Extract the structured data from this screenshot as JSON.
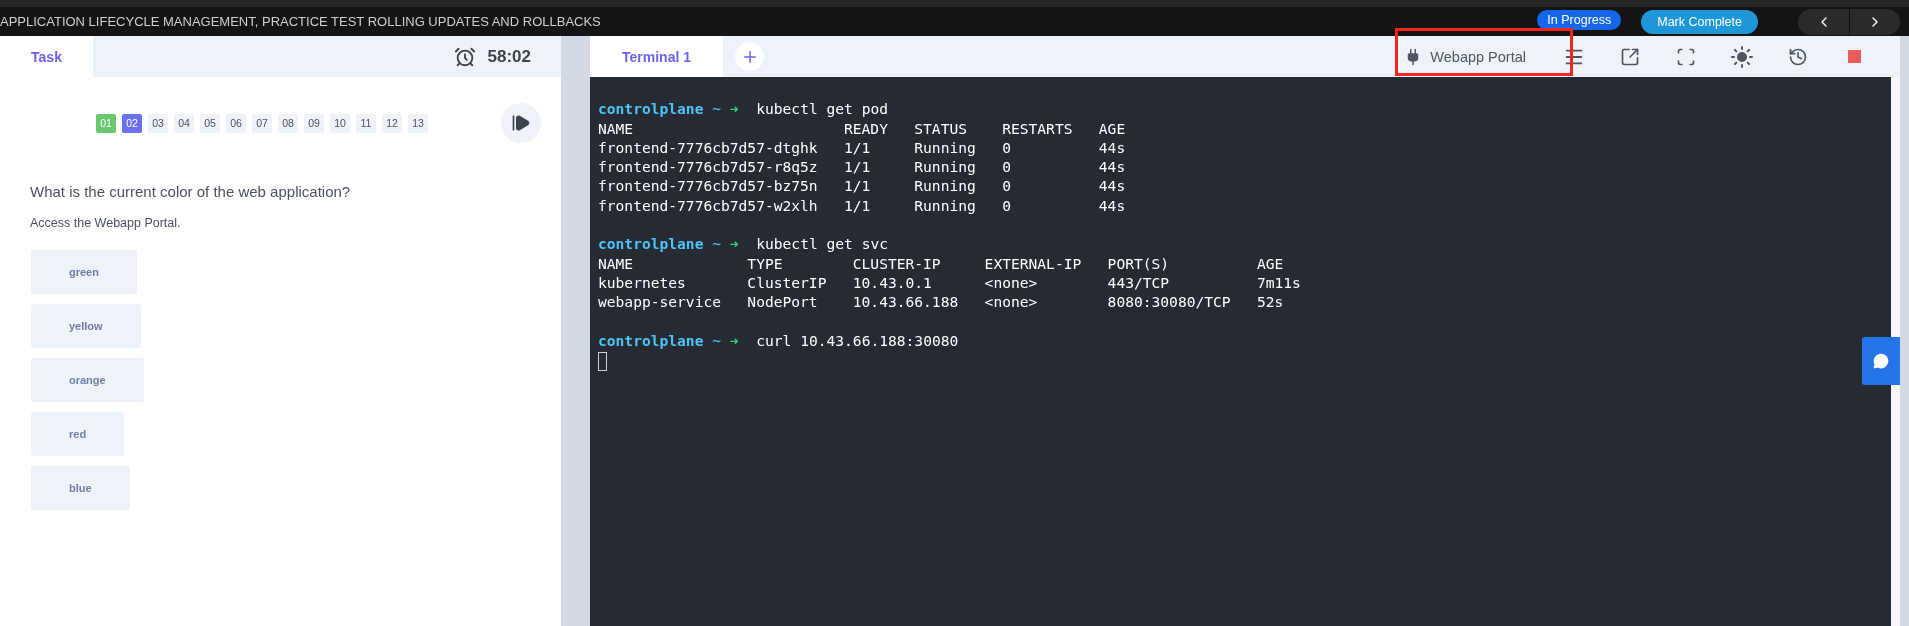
{
  "top_bar": {
    "title": "APPLICATION LIFECYCLE MANAGEMENT, PRACTICE TEST ROLLING UPDATES AND ROLLBACKS",
    "status_badge": "In Progress",
    "mark_complete_button": "Mark Complete"
  },
  "task_panel": {
    "tab": {
      "label": "Task",
      "selected": true
    },
    "timer": "58:02",
    "questions": [
      {
        "label": "01",
        "kind": "done"
      },
      {
        "label": "02",
        "kind": "current"
      },
      {
        "label": "03",
        "kind": "pending"
      },
      {
        "label": "04",
        "kind": "pending"
      },
      {
        "label": "05",
        "kind": "pending"
      },
      {
        "label": "06",
        "kind": "pending"
      },
      {
        "label": "07",
        "kind": "pending"
      },
      {
        "label": "08",
        "kind": "pending"
      },
      {
        "label": "09",
        "kind": "pending"
      },
      {
        "label": "10",
        "kind": "pending"
      },
      {
        "label": "11",
        "kind": "pending"
      },
      {
        "label": "12",
        "kind": "pending"
      },
      {
        "label": "13",
        "kind": "pending"
      }
    ],
    "question": "What is the current color of the web application?",
    "hint": "Access the Webapp Portal.",
    "options": [
      {
        "label": "green",
        "selected": false
      },
      {
        "label": "yellow",
        "selected": false
      },
      {
        "label": "orange",
        "selected": false
      },
      {
        "label": "red",
        "selected": false
      },
      {
        "label": "blue",
        "selected": false
      }
    ]
  },
  "terminal": {
    "tabs": [
      {
        "label": "Terminal 1",
        "selected": true
      }
    ],
    "webapp_portal_button": "Webapp Portal",
    "lines": [
      {
        "kind": "blank"
      },
      {
        "kind": "prompt",
        "host": "controlplane",
        "dir": "~",
        "arrow": "➜",
        "command": "kubectl get pod"
      },
      {
        "kind": "output",
        "text": "NAME                        READY   STATUS    RESTARTS   AGE"
      },
      {
        "kind": "output",
        "text": "frontend-7776cb7d57-dtghk   1/1     Running   0          44s"
      },
      {
        "kind": "output",
        "text": "frontend-7776cb7d57-r8q5z   1/1     Running   0          44s"
      },
      {
        "kind": "output",
        "text": "frontend-7776cb7d57-bz75n   1/1     Running   0          44s"
      },
      {
        "kind": "output",
        "text": "frontend-7776cb7d57-w2xlh   1/1     Running   0          44s"
      },
      {
        "kind": "blank"
      },
      {
        "kind": "prompt",
        "host": "controlplane",
        "dir": "~",
        "arrow": "➜",
        "command": "kubectl get svc"
      },
      {
        "kind": "output",
        "text": "NAME             TYPE        CLUSTER-IP     EXTERNAL-IP   PORT(S)          AGE"
      },
      {
        "kind": "output",
        "text": "kubernetes       ClusterIP   10.43.0.1      <none>        443/TCP          7m11s"
      },
      {
        "kind": "output",
        "text": "webapp-service   NodePort    10.43.66.188   <none>        8080:30080/TCP   52s"
      },
      {
        "kind": "blank"
      },
      {
        "kind": "prompt",
        "host": "controlplane",
        "dir": "~",
        "arrow": "➜",
        "command": "curl 10.43.66.188:30080"
      },
      {
        "kind": "cursor"
      }
    ]
  }
}
